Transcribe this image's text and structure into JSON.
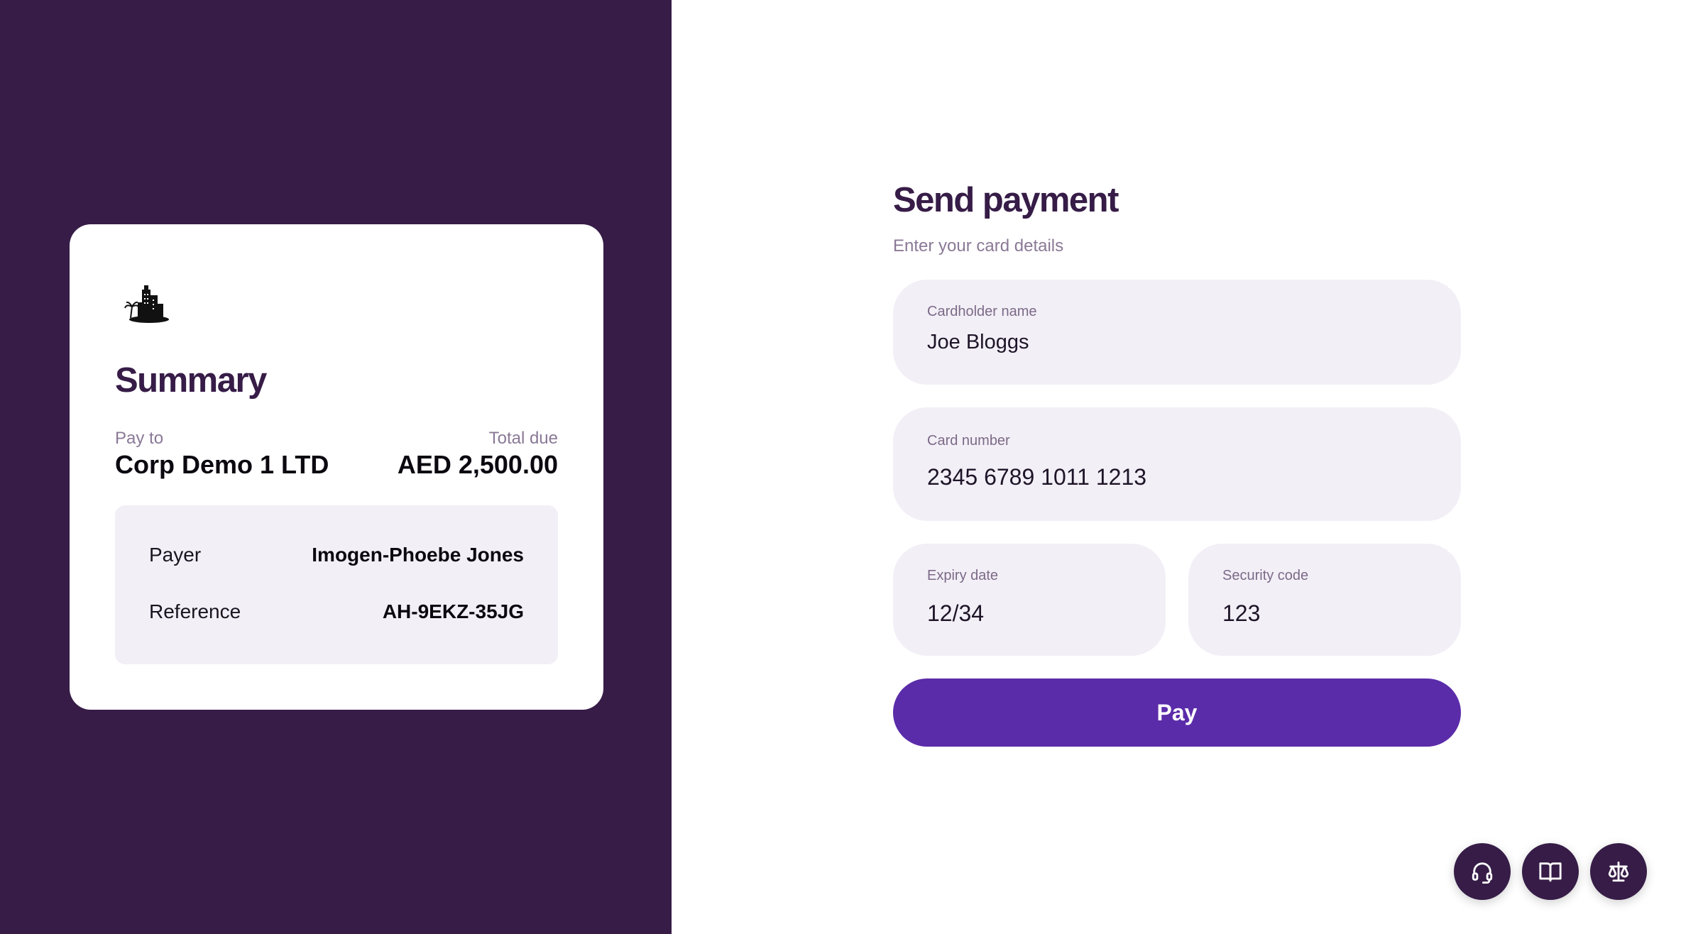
{
  "summary": {
    "logo_icon": "buildings-logo-icon",
    "title": "Summary",
    "pay_to_label": "Pay to",
    "pay_to_value": "Corp Demo 1 LTD",
    "total_label": "Total due",
    "total_value": "AED 2,500.00",
    "details": [
      {
        "label": "Payer",
        "value": "Imogen-Phoebe Jones"
      },
      {
        "label": "Reference",
        "value": "AH-9EKZ-35JG"
      }
    ]
  },
  "form": {
    "title": "Send payment",
    "subtitle": "Enter your card details",
    "cardholder": {
      "label": "Cardholder name",
      "value": "Joe Bloggs"
    },
    "card_number": {
      "label": "Card number",
      "value": "2345 6789 1011 1213"
    },
    "expiry": {
      "label": "Expiry date",
      "value": "12/34"
    },
    "security": {
      "label": "Security code",
      "value": "123"
    },
    "pay_label": "Pay"
  },
  "fabs": [
    {
      "icon": "headset-icon"
    },
    {
      "icon": "book-icon"
    },
    {
      "icon": "scales-icon"
    }
  ],
  "colors": {
    "panel": "#361c47",
    "accent": "#5b2ca9",
    "field_bg": "#f2eff6"
  }
}
